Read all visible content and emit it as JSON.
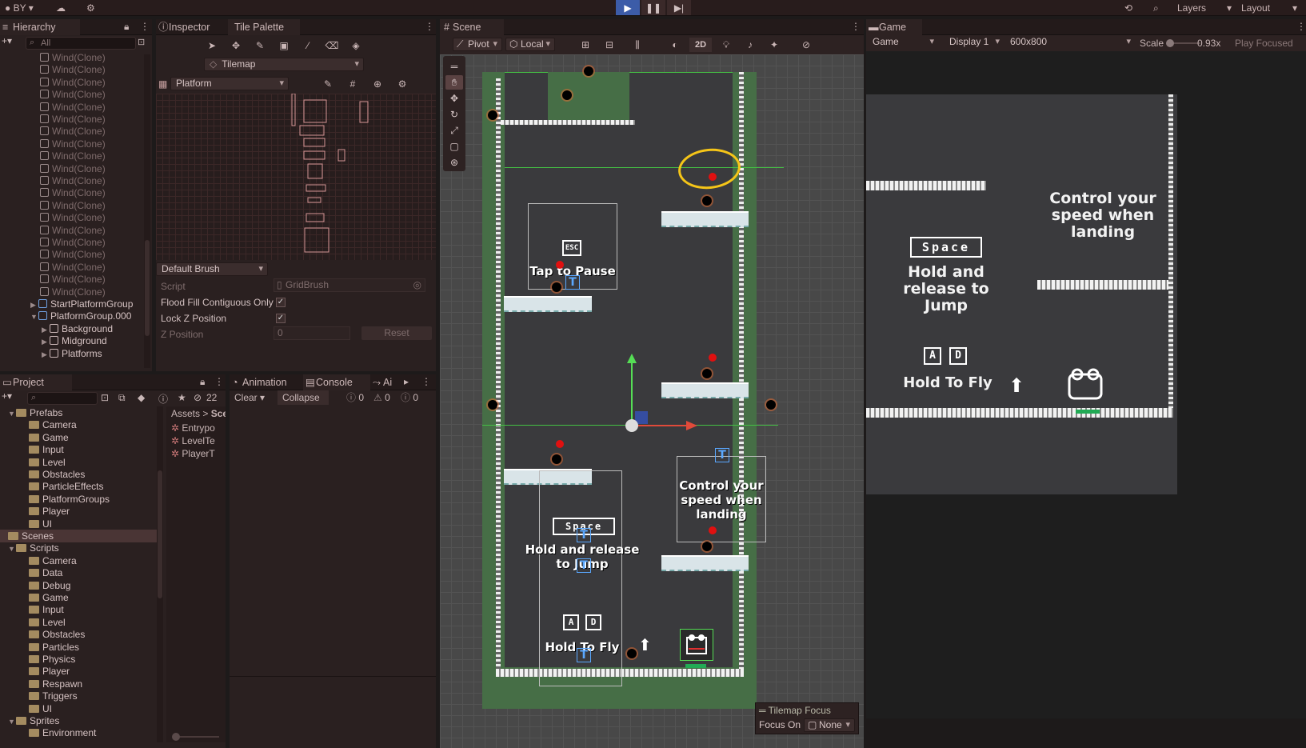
{
  "topbar": {
    "account": "BY",
    "layers_label": "Layers",
    "layout_label": "Layout"
  },
  "hierarchy": {
    "tab": "Hierarchy",
    "search_placeholder": "All",
    "wind_items": [
      "Wind(Clone)",
      "Wind(Clone)",
      "Wind(Clone)",
      "Wind(Clone)",
      "Wind(Clone)",
      "Wind(Clone)",
      "Wind(Clone)",
      "Wind(Clone)",
      "Wind(Clone)",
      "Wind(Clone)",
      "Wind(Clone)",
      "Wind(Clone)",
      "Wind(Clone)",
      "Wind(Clone)",
      "Wind(Clone)",
      "Wind(Clone)",
      "Wind(Clone)",
      "Wind(Clone)",
      "Wind(Clone)",
      "Wind(Clone)"
    ],
    "groups": [
      "StartPlatformGroup",
      "PlatformGroup.000"
    ],
    "children": [
      "Background",
      "Midground",
      "Platforms"
    ]
  },
  "tile_palette": {
    "tabs": [
      "Inspector",
      "Tile Palette"
    ],
    "active_tilemap": "Tilemap",
    "palette": "Platform",
    "brush": "Default Brush",
    "fields": {
      "script_label": "Script",
      "script_value": "GridBrush",
      "flood_label": "Flood Fill Contiguous Only",
      "lock_label": "Lock Z Position",
      "z_label": "Z Position",
      "z_value": "0",
      "reset_label": "Reset"
    }
  },
  "project": {
    "tab": "Project",
    "hidden_count": "22",
    "breadcrumb": [
      "Assets",
      "Sce"
    ],
    "tree": [
      {
        "label": "Prefabs",
        "depth": 0,
        "expanded": true
      },
      {
        "label": "Camera",
        "depth": 1
      },
      {
        "label": "Game",
        "depth": 1
      },
      {
        "label": "Input",
        "depth": 1
      },
      {
        "label": "Level",
        "depth": 1
      },
      {
        "label": "Obstacles",
        "depth": 1
      },
      {
        "label": "ParticleEffects",
        "depth": 1
      },
      {
        "label": "PlatformGroups",
        "depth": 1
      },
      {
        "label": "Player",
        "depth": 1
      },
      {
        "label": "UI",
        "depth": 1
      },
      {
        "label": "Scenes",
        "depth": 0,
        "selected": true
      },
      {
        "label": "Scripts",
        "depth": 0,
        "expanded": true
      },
      {
        "label": "Camera",
        "depth": 1
      },
      {
        "label": "Data",
        "depth": 1
      },
      {
        "label": "Debug",
        "depth": 1
      },
      {
        "label": "Game",
        "depth": 1
      },
      {
        "label": "Input",
        "depth": 1
      },
      {
        "label": "Level",
        "depth": 1
      },
      {
        "label": "Obstacles",
        "depth": 1
      },
      {
        "label": "Particles",
        "depth": 1
      },
      {
        "label": "Physics",
        "depth": 1
      },
      {
        "label": "Player",
        "depth": 1
      },
      {
        "label": "Respawn",
        "depth": 1
      },
      {
        "label": "Triggers",
        "depth": 1
      },
      {
        "label": "UI",
        "depth": 1
      },
      {
        "label": "Sprites",
        "depth": 0,
        "expanded": true
      },
      {
        "label": "Environment",
        "depth": 1
      }
    ],
    "files": [
      "Entrypo",
      "LevelTe",
      "PlayerT"
    ]
  },
  "console": {
    "tabs": [
      "Animation",
      "Console",
      "Ai"
    ],
    "clear": "Clear",
    "collapse": "Collapse",
    "counts": [
      "0",
      "0",
      "0"
    ]
  },
  "scene": {
    "tab": "Scene",
    "pivot": "Pivot",
    "local": "Local",
    "mode_2d": "2D",
    "texts": {
      "tap_pause": "Tap to Pause",
      "esc": "ESC",
      "space": "Space",
      "hold_release": "Hold and release to Jump",
      "control": "Control your speed when landing",
      "key_a": "A",
      "key_d": "D",
      "hold_fly": "Hold To Fly"
    },
    "tilemap_focus": {
      "title": "Tilemap Focus",
      "label": "Focus On",
      "value": "None"
    }
  },
  "game": {
    "tab": "Game",
    "view": "Game",
    "display": "Display 1",
    "resolution": "600x800",
    "scale_label": "Scale",
    "scale_value": "0.93x",
    "scale_fraction": 0.05,
    "play_focused": "Play Focused",
    "texts": {
      "control": "Control your speed when landing",
      "space": "Space",
      "hold_release": "Hold and release to Jump",
      "key_a": "A",
      "key_d": "D",
      "hold_fly": "Hold To Fly"
    }
  }
}
